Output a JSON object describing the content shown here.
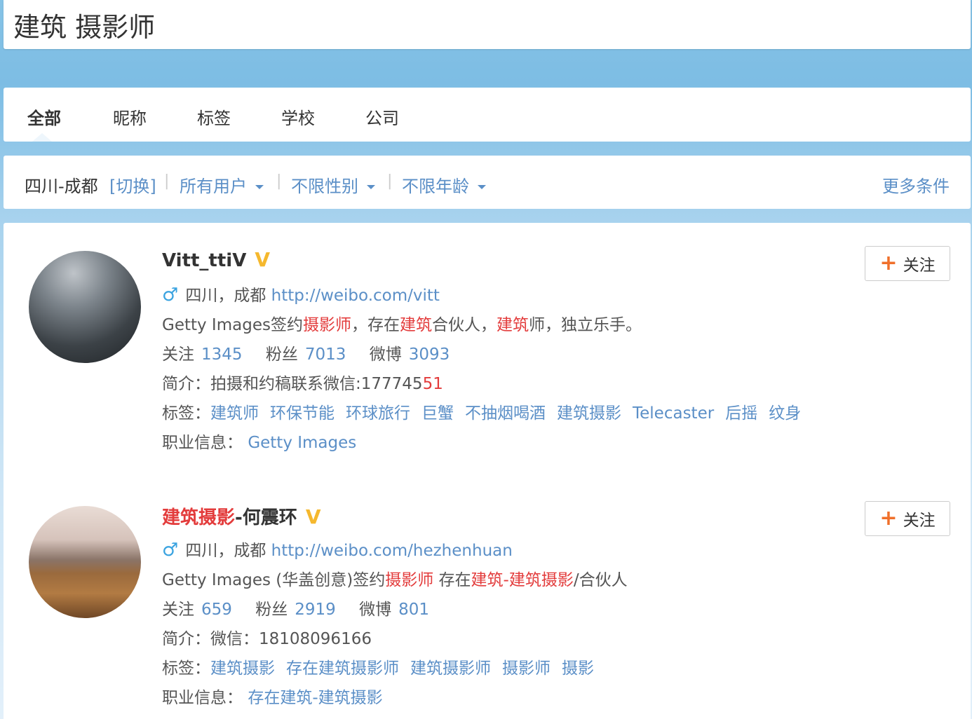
{
  "search": {
    "value": "建筑 摄影师"
  },
  "tabs": [
    {
      "label": "全部",
      "active": true
    },
    {
      "label": "昵称"
    },
    {
      "label": "标签"
    },
    {
      "label": "学校"
    },
    {
      "label": "公司"
    }
  ],
  "filters": {
    "city": "四川-成都",
    "switch_label": "[切换]",
    "user_type": "所有用户",
    "gender": "不限性别",
    "age": "不限年龄",
    "more": "更多条件",
    "separator": "|"
  },
  "users": [
    {
      "name": "Vitt_ttiV",
      "verified_badge": "V",
      "location": "四川，成都",
      "url": "http://weibo.com/vitt",
      "desc_parts": [
        "Getty Images签约",
        "摄影师",
        "，存在",
        "建筑",
        "合伙人，",
        "建筑",
        "师，独立乐手。"
      ],
      "stats": {
        "follow_label": "关注",
        "follow": "1345",
        "fans_label": "粉丝",
        "fans": "7013",
        "weibo_label": "微博",
        "weibo": "3093"
      },
      "bio_label": "简介：",
      "bio_parts": [
        "拍摄和约稿联系微信:177745",
        "51"
      ],
      "tags_label": "标签：",
      "tags": [
        "建筑师",
        "环保节能",
        "环球旅行",
        "巨蟹",
        "不抽烟喝酒",
        "建筑摄影",
        "Telecaster",
        "后摇",
        "纹身"
      ],
      "career_label": "职业信息：",
      "career": "Getty Images",
      "follow_button": "关注"
    },
    {
      "name_hl": "建筑摄影",
      "name_rest": "-何震环",
      "verified_badge": "V",
      "location": "四川，成都",
      "url": "http://weibo.com/hezhenhuan",
      "desc_parts": [
        "Getty Images (华盖创意)签约",
        "摄影师",
        " 存在",
        "建筑-建筑摄影",
        "/合伙人"
      ],
      "stats": {
        "follow_label": "关注",
        "follow": "659",
        "fans_label": "粉丝",
        "fans": "2919",
        "weibo_label": "微博",
        "weibo": "801"
      },
      "bio_label": "简介：",
      "bio": "微信：18108096166",
      "tags_label": "标签：",
      "tags": [
        "建筑摄影",
        "存在建筑摄影师",
        "建筑摄影师",
        "摄影师",
        "摄影"
      ],
      "career_label": "职业信息：",
      "career": "存在建筑-建筑摄影",
      "follow_button": "关注"
    }
  ],
  "icons": {
    "male": "♂",
    "plus": "+"
  },
  "colors": {
    "link": "#5b8fc7",
    "highlight": "#e33c3c",
    "badge": "#f5b82e",
    "plus": "#f0702b"
  }
}
